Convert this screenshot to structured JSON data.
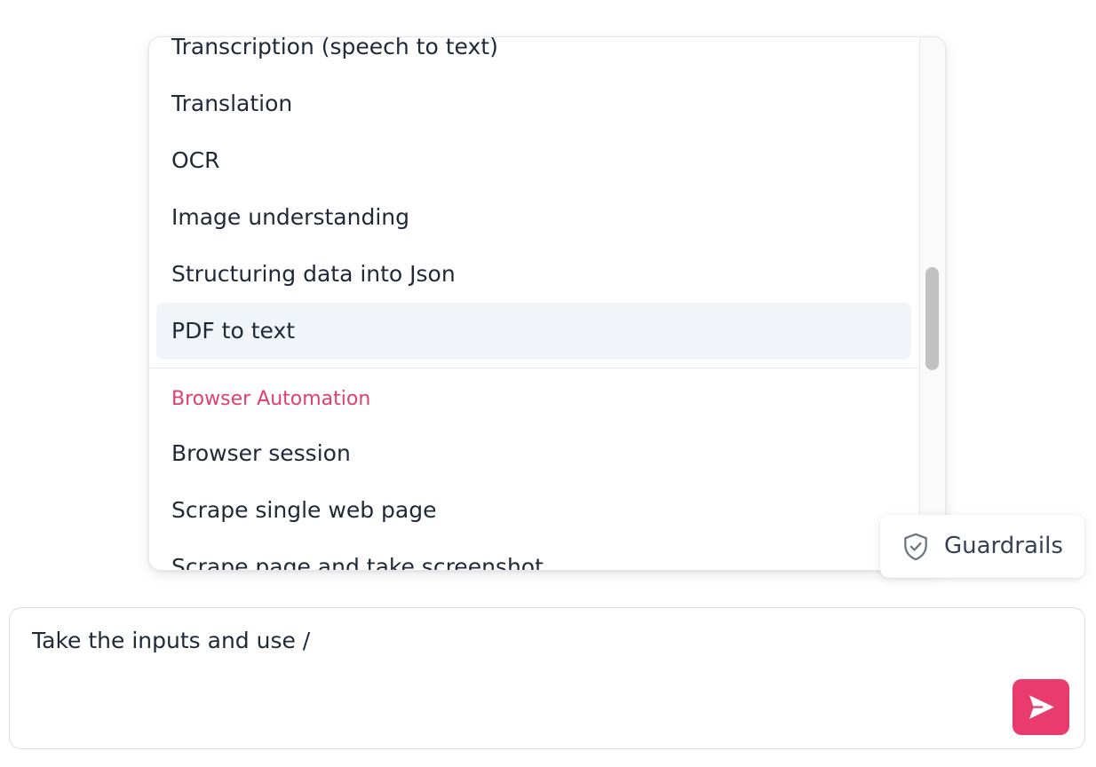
{
  "dropdown": {
    "items": [
      {
        "label": "Transcription (speech to text)"
      },
      {
        "label": "Translation"
      },
      {
        "label": "OCR"
      },
      {
        "label": "Image understanding"
      },
      {
        "label": "Structuring data into Json"
      },
      {
        "label": "PDF to text",
        "highlighted": true
      }
    ],
    "groups": [
      {
        "header": "Browser Automation",
        "items": [
          {
            "label": "Browser session"
          },
          {
            "label": "Scrape single web page"
          },
          {
            "label": "Scrape page and take screenshot"
          }
        ]
      }
    ]
  },
  "guardrails": {
    "label": "Guardrails",
    "icon": "shield-check-icon"
  },
  "composer": {
    "value": "Take the inputs and use /",
    "send_icon": "send-icon"
  },
  "colors": {
    "accent": "#ea3b6e",
    "group_header": "#e23f6c",
    "highlight_bg": "#f1f4f9",
    "text": "#1f2937"
  }
}
